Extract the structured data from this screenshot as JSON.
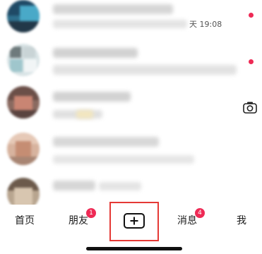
{
  "feed": {
    "first_item_time": "天 19:08"
  },
  "tabbar": {
    "home": "首页",
    "friends": "朋友",
    "friends_badge": "1",
    "messages": "消息",
    "messages_badge": "4",
    "me": "我"
  },
  "icons": {
    "camera": "camera-icon",
    "create": "plus-icon"
  },
  "colors": {
    "badge": "#ee2a55",
    "highlight": "#e53935"
  }
}
